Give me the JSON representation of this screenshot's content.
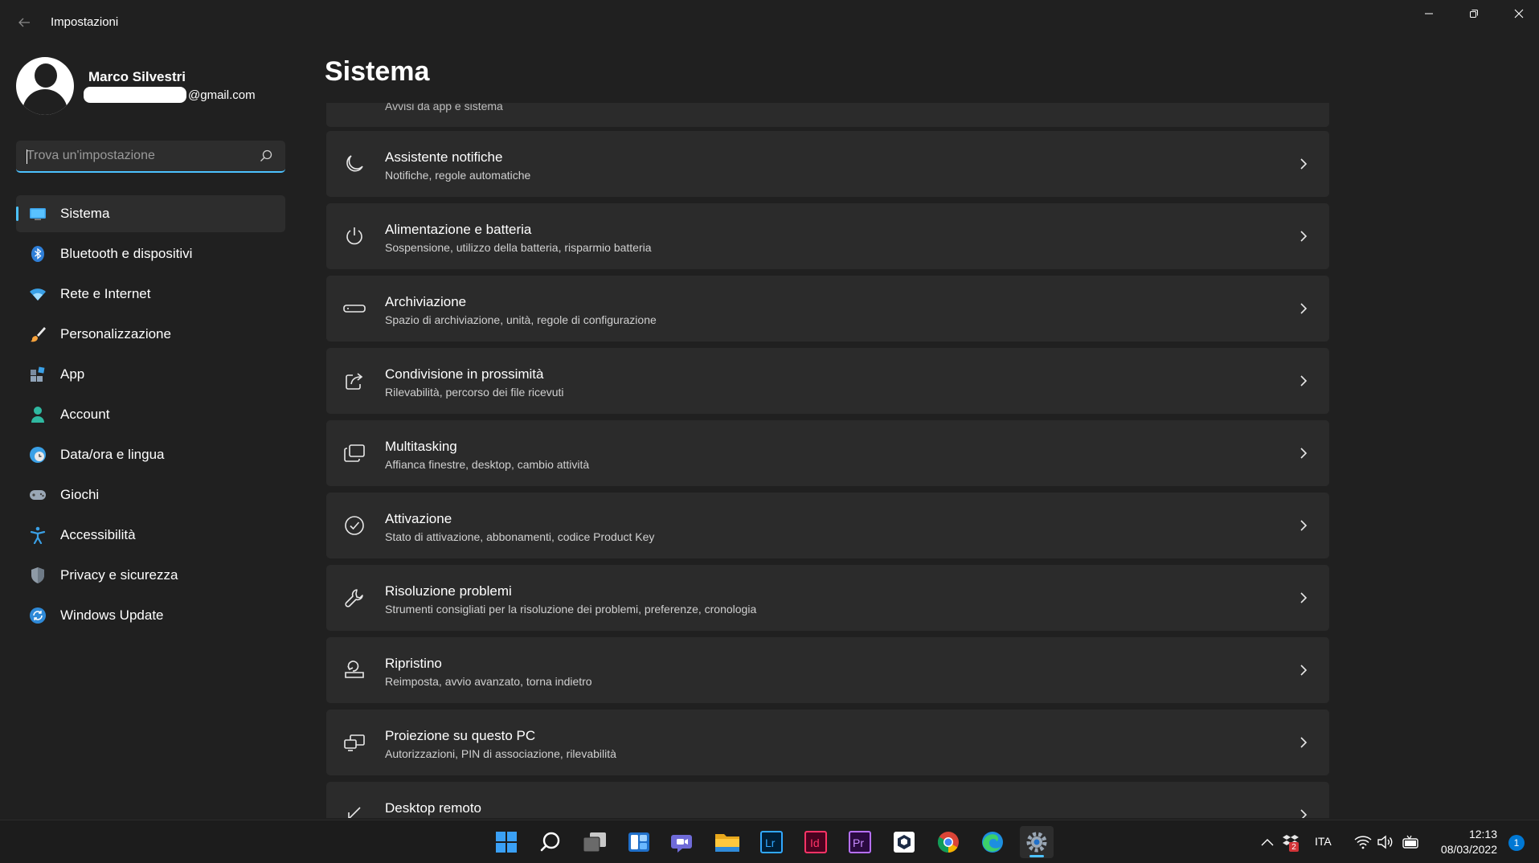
{
  "window": {
    "title": "Impostazioni",
    "controls": [
      "minimize-icon",
      "restore-icon",
      "close-icon"
    ]
  },
  "profile": {
    "name": "Marco Silvestri",
    "email_visible": "@gmail.com"
  },
  "search": {
    "placeholder": "Trova un'impostazione"
  },
  "sidebar": {
    "items": [
      {
        "label": "Sistema",
        "icon": "system-icon",
        "active": true
      },
      {
        "label": "Bluetooth e dispositivi",
        "icon": "bluetooth-icon"
      },
      {
        "label": "Rete e Internet",
        "icon": "wifi-icon"
      },
      {
        "label": "Personalizzazione",
        "icon": "brush-icon"
      },
      {
        "label": "App",
        "icon": "apps-icon"
      },
      {
        "label": "Account",
        "icon": "account-icon"
      },
      {
        "label": "Data/ora e lingua",
        "icon": "globe-clock-icon"
      },
      {
        "label": "Giochi",
        "icon": "gamepad-icon"
      },
      {
        "label": "Accessibilità",
        "icon": "accessibility-icon"
      },
      {
        "label": "Privacy e sicurezza",
        "icon": "shield-icon"
      },
      {
        "label": "Windows Update",
        "icon": "windows-update-icon"
      }
    ]
  },
  "main": {
    "title": "Sistema",
    "partial_top_subtitle": "Avvisi da app e sistema",
    "cards": [
      {
        "title": "Assistente notifiche",
        "subtitle": "Notifiche, regole automatiche",
        "icon": "moon-icon"
      },
      {
        "title": "Alimentazione e batteria",
        "subtitle": "Sospensione, utilizzo della batteria, risparmio batteria",
        "icon": "power-icon"
      },
      {
        "title": "Archiviazione",
        "subtitle": "Spazio di archiviazione, unità, regole di configurazione",
        "icon": "storage-icon"
      },
      {
        "title": "Condivisione in prossimità",
        "subtitle": "Rilevabilità, percorso dei file ricevuti",
        "icon": "share-icon"
      },
      {
        "title": "Multitasking",
        "subtitle": "Affianca finestre, desktop, cambio attività",
        "icon": "multitasking-icon"
      },
      {
        "title": "Attivazione",
        "subtitle": "Stato di attivazione, abbonamenti, codice Product Key",
        "icon": "check-circle-icon"
      },
      {
        "title": "Risoluzione problemi",
        "subtitle": "Strumenti consigliati per la risoluzione dei problemi, preferenze, cronologia",
        "icon": "wrench-icon"
      },
      {
        "title": "Ripristino",
        "subtitle": "Reimposta, avvio avanzato, torna indietro",
        "icon": "recovery-icon"
      },
      {
        "title": "Proiezione su questo PC",
        "subtitle": "Autorizzazioni, PIN di associazione, rilevabilità",
        "icon": "projection-icon"
      },
      {
        "title": "Desktop remoto",
        "subtitle": "",
        "icon": "remote-desktop-icon"
      }
    ]
  },
  "taskbar": {
    "apps": [
      {
        "name": "start-icon"
      },
      {
        "name": "search-icon"
      },
      {
        "name": "task-view-icon"
      },
      {
        "name": "widgets-icon"
      },
      {
        "name": "teams-chat-icon"
      },
      {
        "name": "file-explorer-icon"
      },
      {
        "name": "lightroom-icon",
        "label": "Lr"
      },
      {
        "name": "indesign-icon",
        "label": "Id"
      },
      {
        "name": "premiere-icon",
        "label": "Pr"
      },
      {
        "name": "app-cube-icon"
      },
      {
        "name": "chrome-icon"
      },
      {
        "name": "edge-icon"
      },
      {
        "name": "settings-gear-icon",
        "active": true
      }
    ],
    "language": "ITA",
    "tray_badge": "2",
    "time": "12:13",
    "date": "08/03/2022",
    "notifications": "1"
  },
  "colors": {
    "accent": "#4cc2ff",
    "background": "#202020",
    "card": "#2b2b2b"
  }
}
